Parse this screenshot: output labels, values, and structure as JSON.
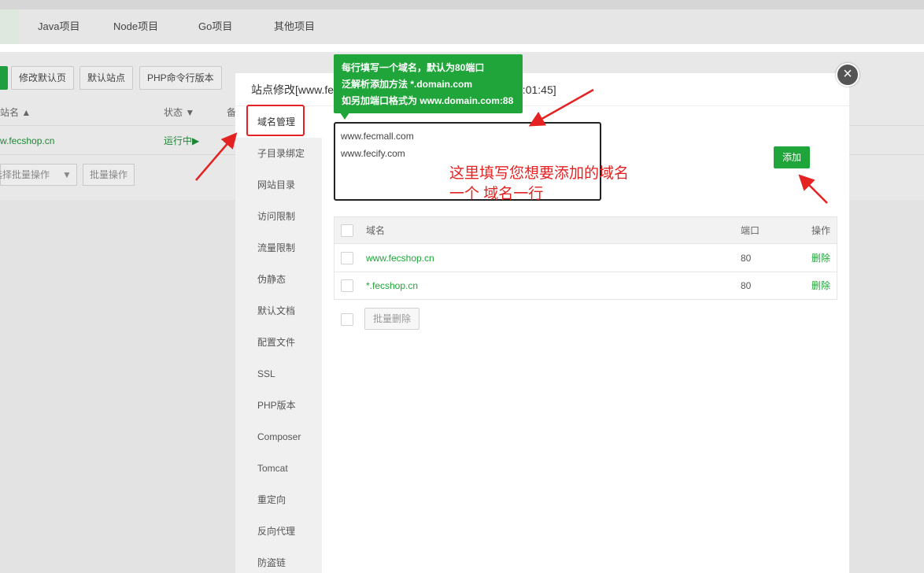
{
  "background": {
    "tabs": [
      "Java项目",
      "Node项目",
      "Go项目",
      "其他项目"
    ],
    "toolbar_buttons": [
      "修改默认页",
      "默认站点",
      "PHP命令行版本"
    ],
    "table_headers": {
      "site_name": "站名",
      "status": "状态",
      "note": "备"
    },
    "row": {
      "site": "w.fecshop.cn",
      "status": "运行中▶"
    },
    "select_batch_label": "选择批量操作",
    "batch_button": "批量操作"
  },
  "modal": {
    "title": "站点修改[www.fe",
    "title_tail": "0:01:45]",
    "close_symbol": "×",
    "sidebar_items": [
      "域名管理",
      "子目录绑定",
      "网站目录",
      "访问限制",
      "流量限制",
      "伪静态",
      "默认文档",
      "配置文件",
      "SSL",
      "PHP版本",
      "Composer",
      "Tomcat",
      "重定向",
      "反向代理",
      "防盗链"
    ],
    "domain_input_value": "www.fecmall.com\nwww.fecify.com",
    "add_button": "添加",
    "table": {
      "headers": {
        "domain": "域名",
        "port": "端口",
        "action": "操作"
      },
      "rows": [
        {
          "domain": "www.fecshop.cn",
          "port": "80",
          "action": "删除"
        },
        {
          "domain": "*.fecshop.cn",
          "port": "80",
          "action": "删除"
        }
      ]
    },
    "batch_delete": "批量删除"
  },
  "tooltip": {
    "lines": [
      "每行填写一个域名，默认为80端口",
      "泛解析添加方法 *.domain.com",
      "如另加端口格式为 www.domain.com:88"
    ]
  },
  "annotation": {
    "line1": "这里填写您想要添加的域名",
    "line2": "一个 域名一行"
  },
  "colors": {
    "accent_green": "#20a53a",
    "annotation_red": "#e52222"
  }
}
